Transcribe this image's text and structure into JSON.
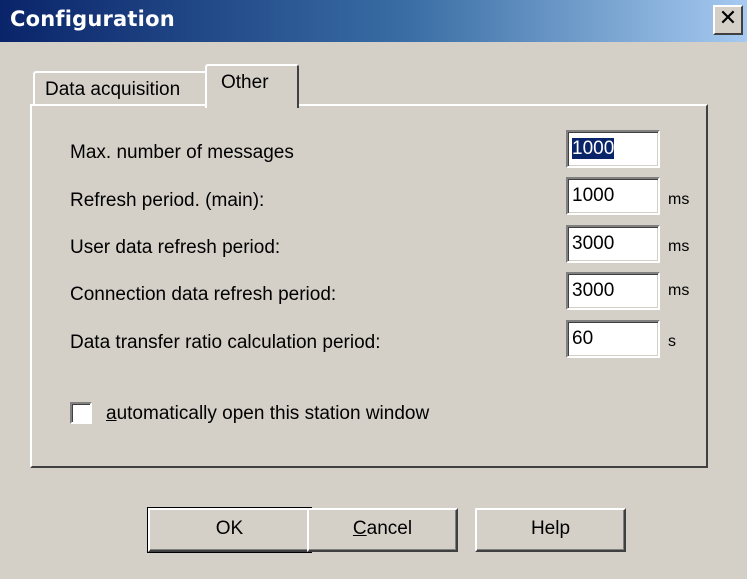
{
  "window": {
    "title": "Configuration",
    "close_glyph": "✕"
  },
  "tabs": [
    {
      "label": "Data acquisition",
      "active": false
    },
    {
      "label": "Other",
      "active": true
    }
  ],
  "settings": [
    {
      "label": "Max. number of messages",
      "value": "1000",
      "unit": "",
      "selected": true
    },
    {
      "label": "Refresh period. (main):",
      "value": "1000",
      "unit": "ms"
    },
    {
      "label": "User data refresh period:",
      "value": "3000",
      "unit": "ms"
    },
    {
      "label": "Connection data refresh period:",
      "value": "3000",
      "unit": "ms"
    },
    {
      "label": "Data transfer ratio calculation period:",
      "value": "60",
      "unit": "s"
    }
  ],
  "checkbox": {
    "checked": false,
    "label_accel": "a",
    "label_rest": "utomatically open this station window"
  },
  "buttons": {
    "ok": "OK",
    "cancel_accel": "C",
    "cancel_rest": "ancel",
    "help": "Help"
  },
  "colors": {
    "face": "#d4d0c8",
    "title_gradient_start": "#0a246a",
    "title_gradient_end": "#a6caf0",
    "selection": "#0a246a"
  }
}
